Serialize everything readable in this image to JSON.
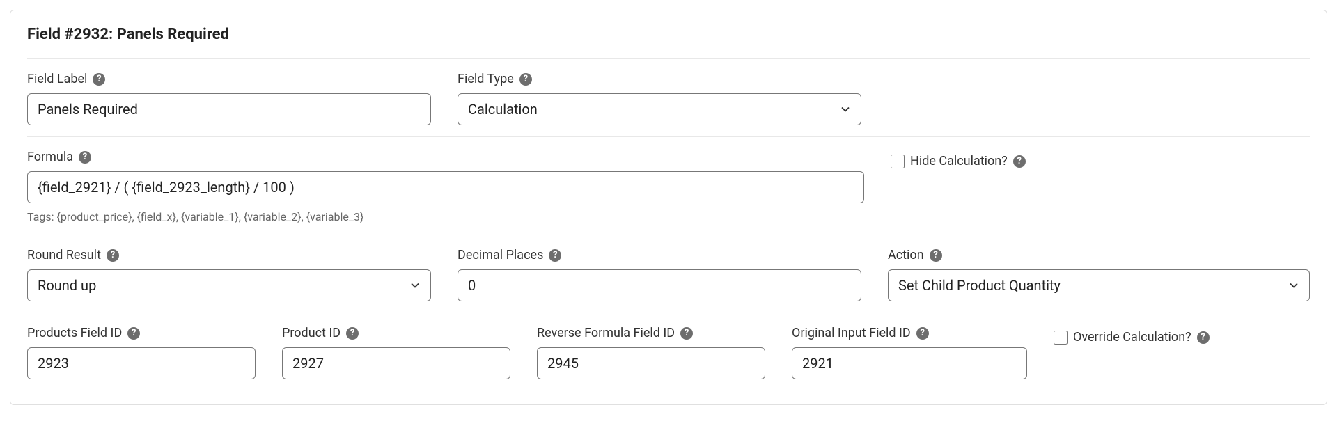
{
  "title": "Field #2932: Panels Required",
  "labels": {
    "field_label": "Field Label",
    "field_type": "Field Type",
    "formula": "Formula",
    "hide_calc": "Hide Calculation?",
    "round_result": "Round Result",
    "decimal_places": "Decimal Places",
    "action": "Action",
    "products_field_id": "Products Field ID",
    "product_id": "Product ID",
    "reverse_formula_field_id": "Reverse Formula Field ID",
    "original_input_field_id": "Original Input Field ID",
    "override_calc": "Override Calculation?"
  },
  "values": {
    "field_label": "Panels Required",
    "field_type": "Calculation",
    "formula": "{field_2921} / ( {field_2923_length} / 100 )",
    "round_result": "Round up",
    "decimal_places": "0",
    "action": "Set Child Product Quantity",
    "products_field_id": "2923",
    "product_id": "2927",
    "reverse_formula_field_id": "2945",
    "original_input_field_id": "2921"
  },
  "hints": {
    "tags": "Tags: {product_price}, {field_x}, {variable_1}, {variable_2}, {variable_3}"
  },
  "help_glyph": "?"
}
